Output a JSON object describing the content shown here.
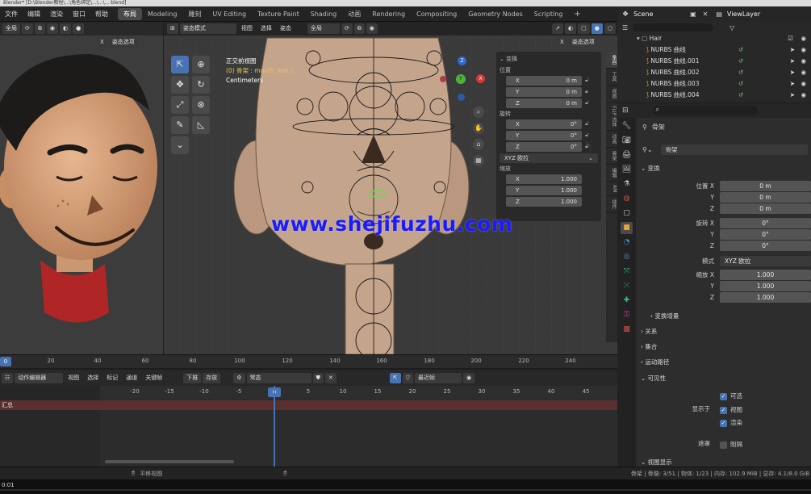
{
  "titlebar": {
    "text": "Blender* [D:\\Blender教程\\...\\角色绑定\\...\\...\\... blend]"
  },
  "menu": [
    "文件",
    "编辑",
    "渲染",
    "窗口",
    "帮助"
  ],
  "workspaces": [
    "布局",
    "Modeling",
    "雕刻",
    "UV Editing",
    "Texture Paint",
    "Shading",
    "动画",
    "Rendering",
    "Compositing",
    "Geometry Nodes",
    "Scripting"
  ],
  "workspace_active_index": 0,
  "add_tab_icon": "plus-icon",
  "left_view": {
    "header": {
      "view_label": "全局",
      "mode_label": "姿态选项"
    },
    "x_label": "X"
  },
  "main_view": {
    "header": {
      "mode": "姿态模式",
      "view": "视图",
      "select": "选择",
      "pose": "姿态",
      "orientation": "全局",
      "pose_options": "姿态选项"
    },
    "overlay": {
      "view_name": "正交前视图",
      "active": "(0) 骨架 : mouth_line_c",
      "units": "Centimeters"
    },
    "gizmo": {
      "z": "Z",
      "y": "Y",
      "x": "X"
    }
  },
  "n_panel": {
    "title": "变换",
    "location": {
      "label": "位置",
      "x": "0 m",
      "y": "0 m",
      "z": "0 m"
    },
    "rotation": {
      "label": "旋转",
      "x": "0°",
      "y": "0°",
      "z": "0°",
      "mode": "XYZ 欧拉"
    },
    "scale": {
      "label": "缩放",
      "x": "1.000",
      "y": "1.000",
      "z": "1.000"
    },
    "axis_labels": {
      "x": "X",
      "y": "Y",
      "z": "Z"
    }
  },
  "vertical_tabs": [
    "条目",
    "工具",
    "视图",
    "FLIP 流体",
    "动画",
    "骨架",
    "编辑",
    "AM",
    "插件"
  ],
  "timeline": {
    "ruler": [
      "0",
      "20",
      "40",
      "60",
      "80",
      "100",
      "120",
      "140",
      "160",
      "180",
      "200",
      "220",
      "240"
    ],
    "current_frame": "0",
    "dopesheet": {
      "editor_label": "动作编辑器",
      "menus": [
        "视图",
        "选择",
        "标记",
        "通道",
        "关键帧"
      ],
      "push_down": "下推",
      "stash": "存放",
      "action_name": "常态",
      "snap": "最近帧",
      "summary": "汇总"
    },
    "ds_ruler": [
      "-20",
      "-15",
      "-10",
      "-5",
      "0",
      "5",
      "10",
      "15",
      "20",
      "25",
      "30",
      "35",
      "40",
      "45"
    ]
  },
  "statusbar": {
    "left": "平移视图",
    "right": "骨架 | 骨骼: 3/51 | 物体: 1/23 | 内存: 102.9 MiB | 显存: 4.1/8.0 GiB"
  },
  "bottom_text": "0:01",
  "outliner": {
    "scene": "Scene",
    "view_layer": "ViewLayer",
    "collection": "Hair",
    "items": [
      "NURBS 曲线",
      "NURBS 曲线.001",
      "NURBS 曲线.002",
      "NURBS 曲线.003",
      "NURBS 曲线.004"
    ]
  },
  "properties": {
    "object_name": "骨架",
    "data_name": "骨架",
    "transform_label": "变换",
    "location": {
      "label": "位置 X",
      "x": "0 m",
      "y_label": "Y",
      "y": "0 m",
      "z_label": "Z",
      "z": "0 m"
    },
    "rotation": {
      "label": "旋转 X",
      "x": "0°",
      "y_label": "Y",
      "y": "0°",
      "z_label": "Z",
      "z": "0°"
    },
    "mode": {
      "label": "模式",
      "value": "XYZ 欧拉"
    },
    "scale": {
      "label": "缩放 X",
      "x": "1.000",
      "y_label": "Y",
      "y": "1.000",
      "z_label": "Z",
      "z": "1.000"
    },
    "delta": "变换增量",
    "relations": "关系",
    "collections": "集合",
    "motion_paths": "运动路径",
    "visibility": "可见性",
    "selectable": "可选",
    "show_in": "显示于",
    "viewport": "视图",
    "render": "渲染",
    "mask": "遮罩",
    "holdout": "阻隔",
    "viewport_display": "视图显示"
  },
  "watermark": "www.shejifuzhu.com",
  "colors": {
    "accent": "#4772b3",
    "watermark": "#1b1bff",
    "playhead": "#4772b3",
    "skin": "#c9a185"
  }
}
